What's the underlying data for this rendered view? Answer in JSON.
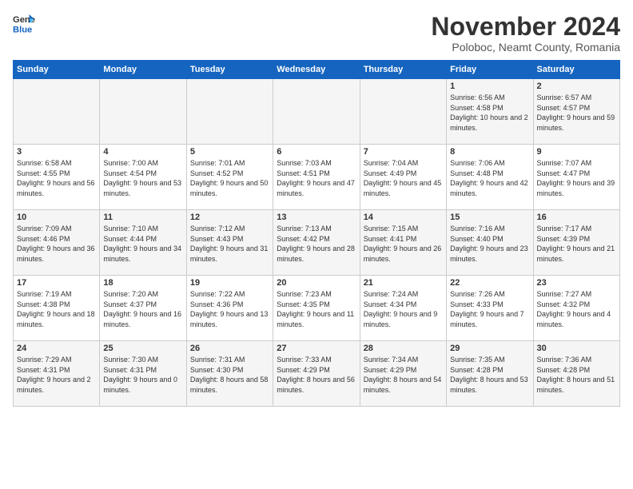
{
  "logo": {
    "line1": "General",
    "line2": "Blue"
  },
  "title": "November 2024",
  "subtitle": "Poloboc, Neamt County, Romania",
  "headers": [
    "Sunday",
    "Monday",
    "Tuesday",
    "Wednesday",
    "Thursday",
    "Friday",
    "Saturday"
  ],
  "weeks": [
    [
      {
        "day": "",
        "sunrise": "",
        "sunset": "",
        "daylight": ""
      },
      {
        "day": "",
        "sunrise": "",
        "sunset": "",
        "daylight": ""
      },
      {
        "day": "",
        "sunrise": "",
        "sunset": "",
        "daylight": ""
      },
      {
        "day": "",
        "sunrise": "",
        "sunset": "",
        "daylight": ""
      },
      {
        "day": "",
        "sunrise": "",
        "sunset": "",
        "daylight": ""
      },
      {
        "day": "1",
        "sunrise": "Sunrise: 6:56 AM",
        "sunset": "Sunset: 4:58 PM",
        "daylight": "Daylight: 10 hours and 2 minutes."
      },
      {
        "day": "2",
        "sunrise": "Sunrise: 6:57 AM",
        "sunset": "Sunset: 4:57 PM",
        "daylight": "Daylight: 9 hours and 59 minutes."
      }
    ],
    [
      {
        "day": "3",
        "sunrise": "Sunrise: 6:58 AM",
        "sunset": "Sunset: 4:55 PM",
        "daylight": "Daylight: 9 hours and 56 minutes."
      },
      {
        "day": "4",
        "sunrise": "Sunrise: 7:00 AM",
        "sunset": "Sunset: 4:54 PM",
        "daylight": "Daylight: 9 hours and 53 minutes."
      },
      {
        "day": "5",
        "sunrise": "Sunrise: 7:01 AM",
        "sunset": "Sunset: 4:52 PM",
        "daylight": "Daylight: 9 hours and 50 minutes."
      },
      {
        "day": "6",
        "sunrise": "Sunrise: 7:03 AM",
        "sunset": "Sunset: 4:51 PM",
        "daylight": "Daylight: 9 hours and 47 minutes."
      },
      {
        "day": "7",
        "sunrise": "Sunrise: 7:04 AM",
        "sunset": "Sunset: 4:49 PM",
        "daylight": "Daylight: 9 hours and 45 minutes."
      },
      {
        "day": "8",
        "sunrise": "Sunrise: 7:06 AM",
        "sunset": "Sunset: 4:48 PM",
        "daylight": "Daylight: 9 hours and 42 minutes."
      },
      {
        "day": "9",
        "sunrise": "Sunrise: 7:07 AM",
        "sunset": "Sunset: 4:47 PM",
        "daylight": "Daylight: 9 hours and 39 minutes."
      }
    ],
    [
      {
        "day": "10",
        "sunrise": "Sunrise: 7:09 AM",
        "sunset": "Sunset: 4:46 PM",
        "daylight": "Daylight: 9 hours and 36 minutes."
      },
      {
        "day": "11",
        "sunrise": "Sunrise: 7:10 AM",
        "sunset": "Sunset: 4:44 PM",
        "daylight": "Daylight: 9 hours and 34 minutes."
      },
      {
        "day": "12",
        "sunrise": "Sunrise: 7:12 AM",
        "sunset": "Sunset: 4:43 PM",
        "daylight": "Daylight: 9 hours and 31 minutes."
      },
      {
        "day": "13",
        "sunrise": "Sunrise: 7:13 AM",
        "sunset": "Sunset: 4:42 PM",
        "daylight": "Daylight: 9 hours and 28 minutes."
      },
      {
        "day": "14",
        "sunrise": "Sunrise: 7:15 AM",
        "sunset": "Sunset: 4:41 PM",
        "daylight": "Daylight: 9 hours and 26 minutes."
      },
      {
        "day": "15",
        "sunrise": "Sunrise: 7:16 AM",
        "sunset": "Sunset: 4:40 PM",
        "daylight": "Daylight: 9 hours and 23 minutes."
      },
      {
        "day": "16",
        "sunrise": "Sunrise: 7:17 AM",
        "sunset": "Sunset: 4:39 PM",
        "daylight": "Daylight: 9 hours and 21 minutes."
      }
    ],
    [
      {
        "day": "17",
        "sunrise": "Sunrise: 7:19 AM",
        "sunset": "Sunset: 4:38 PM",
        "daylight": "Daylight: 9 hours and 18 minutes."
      },
      {
        "day": "18",
        "sunrise": "Sunrise: 7:20 AM",
        "sunset": "Sunset: 4:37 PM",
        "daylight": "Daylight: 9 hours and 16 minutes."
      },
      {
        "day": "19",
        "sunrise": "Sunrise: 7:22 AM",
        "sunset": "Sunset: 4:36 PM",
        "daylight": "Daylight: 9 hours and 13 minutes."
      },
      {
        "day": "20",
        "sunrise": "Sunrise: 7:23 AM",
        "sunset": "Sunset: 4:35 PM",
        "daylight": "Daylight: 9 hours and 11 minutes."
      },
      {
        "day": "21",
        "sunrise": "Sunrise: 7:24 AM",
        "sunset": "Sunset: 4:34 PM",
        "daylight": "Daylight: 9 hours and 9 minutes."
      },
      {
        "day": "22",
        "sunrise": "Sunrise: 7:26 AM",
        "sunset": "Sunset: 4:33 PM",
        "daylight": "Daylight: 9 hours and 7 minutes."
      },
      {
        "day": "23",
        "sunrise": "Sunrise: 7:27 AM",
        "sunset": "Sunset: 4:32 PM",
        "daylight": "Daylight: 9 hours and 4 minutes."
      }
    ],
    [
      {
        "day": "24",
        "sunrise": "Sunrise: 7:29 AM",
        "sunset": "Sunset: 4:31 PM",
        "daylight": "Daylight: 9 hours and 2 minutes."
      },
      {
        "day": "25",
        "sunrise": "Sunrise: 7:30 AM",
        "sunset": "Sunset: 4:31 PM",
        "daylight": "Daylight: 9 hours and 0 minutes."
      },
      {
        "day": "26",
        "sunrise": "Sunrise: 7:31 AM",
        "sunset": "Sunset: 4:30 PM",
        "daylight": "Daylight: 8 hours and 58 minutes."
      },
      {
        "day": "27",
        "sunrise": "Sunrise: 7:33 AM",
        "sunset": "Sunset: 4:29 PM",
        "daylight": "Daylight: 8 hours and 56 minutes."
      },
      {
        "day": "28",
        "sunrise": "Sunrise: 7:34 AM",
        "sunset": "Sunset: 4:29 PM",
        "daylight": "Daylight: 8 hours and 54 minutes."
      },
      {
        "day": "29",
        "sunrise": "Sunrise: 7:35 AM",
        "sunset": "Sunset: 4:28 PM",
        "daylight": "Daylight: 8 hours and 53 minutes."
      },
      {
        "day": "30",
        "sunrise": "Sunrise: 7:36 AM",
        "sunset": "Sunset: 4:28 PM",
        "daylight": "Daylight: 8 hours and 51 minutes."
      }
    ]
  ]
}
